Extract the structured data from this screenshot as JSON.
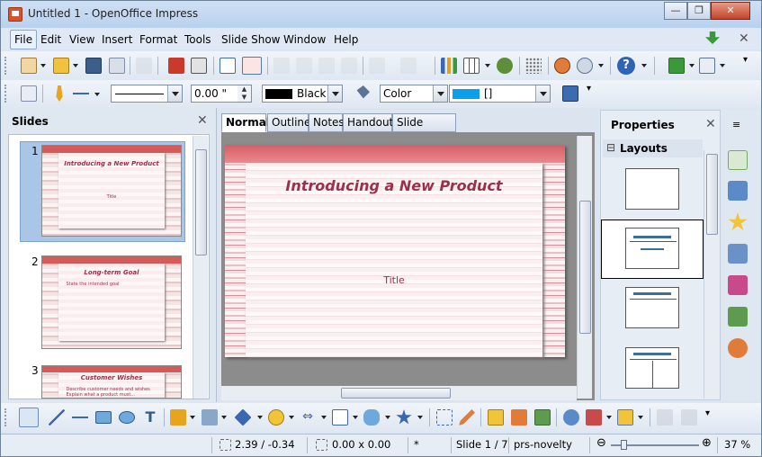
{
  "window": {
    "title": "Untitled 1 - OpenOffice Impress",
    "min_label": "—",
    "max_label": "❐",
    "close_label": "✕"
  },
  "menu": [
    "File",
    "Edit",
    "View",
    "Insert",
    "Format",
    "Tools",
    "Slide Show",
    "Window",
    "Help"
  ],
  "line_toolbar": {
    "line_width": "0.00 \"",
    "line_color": "Black",
    "area_style": "Color",
    "area_color": "[]"
  },
  "slides_panel": {
    "title": "Slides",
    "slides": [
      {
        "number": "1",
        "title": "Introducing a New Product",
        "subtitle": "Title",
        "selected": true
      },
      {
        "number": "2",
        "title": "Long-term Goal",
        "bullets": [
          "State the intended goal"
        ]
      },
      {
        "number": "3",
        "title": "Customer Wishes",
        "bullets": [
          "Describe customer needs and wishes",
          "Explain what a product must..."
        ]
      }
    ]
  },
  "view_tabs": [
    "Normal",
    "Outline",
    "Notes",
    "Handout",
    "Slide Sorter"
  ],
  "active_tab": "Normal",
  "slide": {
    "title": "Introducing a New Product",
    "subtitle": "Title"
  },
  "properties": {
    "title": "Properties",
    "section": "Layouts",
    "section_toggle": "⊟"
  },
  "status": {
    "position": "2.39 / -0.34",
    "size": "0.00 x 0.00",
    "modified": "*",
    "slide": "Slide 1 / 7",
    "design": "prs-novelty",
    "zoom": "37 %"
  },
  "colors": {
    "accent_title": "#9e2f4b",
    "selection": "#a9c6e6"
  }
}
